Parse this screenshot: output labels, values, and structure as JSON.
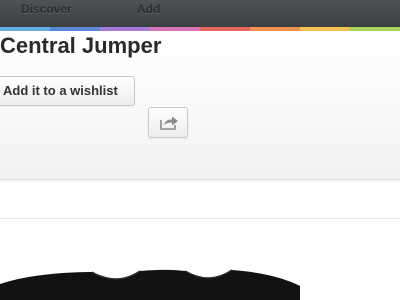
{
  "nav": {
    "items": [
      {
        "label": "Discover"
      },
      {
        "label": "Add"
      }
    ]
  },
  "stripe_colors": [
    "#62b0df",
    "#5a88d6",
    "#a67bd8",
    "#d974b8",
    "#e8665c",
    "#f0924d",
    "#f3c24f",
    "#a9d45d"
  ],
  "product": {
    "title": "Central Jumper",
    "wishlist_label": "Add it to a wishlist",
    "share_icon": "share-arrow-icon",
    "image_icon": "sweater-image"
  }
}
